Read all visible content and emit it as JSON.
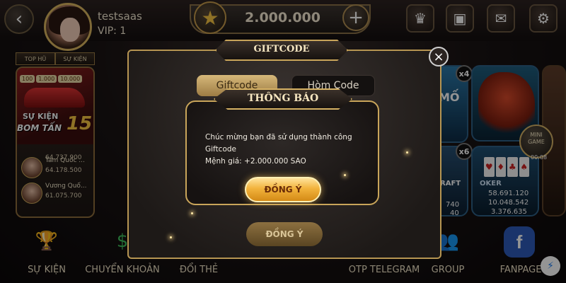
{
  "header": {
    "back_icon": "back-arrow-icon",
    "username": "testsaas",
    "vip": "VIP: 1",
    "balance": "2.000.000",
    "star_icon": "star-icon",
    "add_icon": "plus-icon",
    "icons": [
      "crown-icon",
      "gift-icon",
      "mail-icon",
      "gear-icon"
    ]
  },
  "leaderboard": {
    "tabs": [
      "TOP HŨ",
      "SỰ KIỆN"
    ],
    "banner": {
      "amounts": [
        "100",
        "1.000",
        "10.000"
      ],
      "line1": "SỰ KIỆN",
      "line2": "BOM TẤN",
      "number": "15"
    },
    "rows": [
      {
        "name": "",
        "score": "64.737.900"
      },
      {
        "name": "Tam Quốc ...",
        "score": "64.178.500"
      },
      {
        "name": "Vương Quố...",
        "score": "61.075.700"
      }
    ]
  },
  "tiles": {
    "mult_a": "x4",
    "mult_b": "x6",
    "tile_a_text": "MỐ",
    "tile_c_text": "RAFT",
    "tile_d_scores": [
      "58.691.120",
      "10.048.542",
      "3.376.635"
    ],
    "tile_c_scores": [
      "740",
      "40"
    ],
    "poker": "OKER",
    "card_symbols": [
      "♥",
      "♦",
      "♣",
      "♠"
    ]
  },
  "minigame": {
    "line1": "MINI",
    "line2": "GAME",
    "timer": "00:08"
  },
  "bottom_nav": [
    {
      "label": "SỰ KIỆN",
      "icon": "trophy-icon"
    },
    {
      "label": "CHUYỂN KHOẢN",
      "icon": "money-transfer-icon"
    },
    {
      "label": "ĐỔI THẺ",
      "icon": "card-icon"
    },
    {
      "label": "OTP TELEGRAM",
      "icon": "telegram-icon"
    },
    {
      "label": "GROUP",
      "icon": "group-icon"
    },
    {
      "label": "FANPAGE",
      "icon": "facebook-icon"
    }
  ],
  "giftcode_modal": {
    "title": "GIFTCODE",
    "tabs": [
      "Giftcode",
      "Hòm Code"
    ],
    "close_icon": "close-icon",
    "background_button": "ĐỒNG Ý"
  },
  "notice_modal": {
    "title": "THÔNG BÁO",
    "message_line1": "Chúc mừng bạn đã sử dụng thành công Giftcode",
    "message_line2": "Mệnh giá: +2.000.000 SAO",
    "confirm": "ĐỒNG Ý"
  }
}
